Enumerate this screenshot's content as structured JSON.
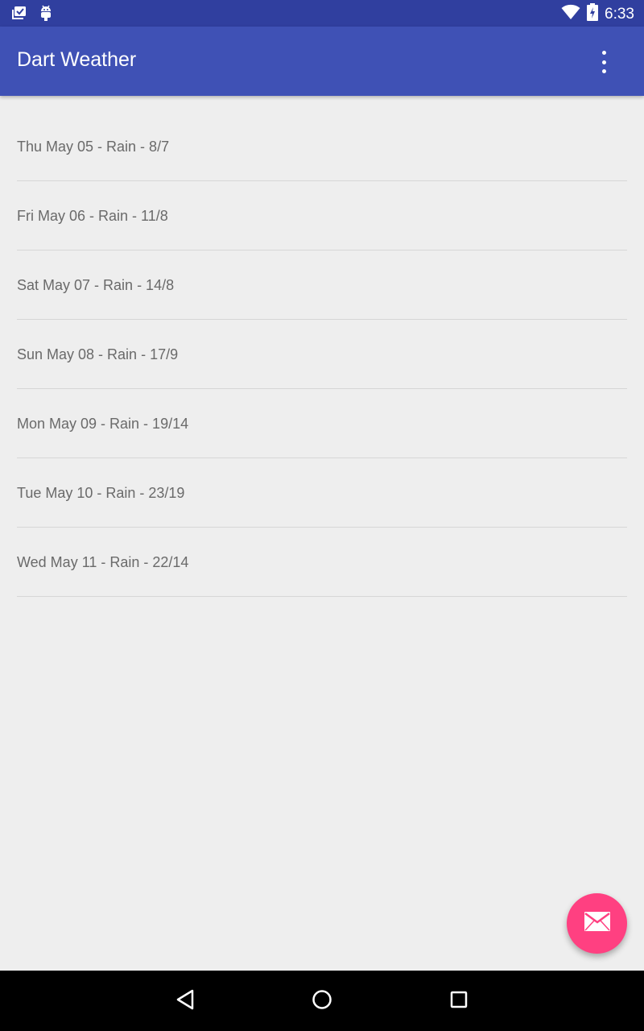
{
  "status_bar": {
    "time": "6:33",
    "icons": [
      "notification-stack-icon",
      "android-icon",
      "wifi-icon",
      "battery-charging-icon"
    ]
  },
  "app_bar": {
    "title": "Dart Weather",
    "overflow_icon": "more-vert-icon"
  },
  "forecast": {
    "items": [
      {
        "label": "Thu May 05 - Rain - 8/7"
      },
      {
        "label": "Fri May 06 - Rain - 11/8"
      },
      {
        "label": "Sat May 07 - Rain - 14/8"
      },
      {
        "label": "Sun May 08 - Rain - 17/9"
      },
      {
        "label": "Mon May 09 - Rain - 19/14"
      },
      {
        "label": "Tue May 10 - Rain - 23/19"
      },
      {
        "label": "Wed May 11 - Rain - 22/14"
      }
    ]
  },
  "fab": {
    "icon": "email-icon"
  },
  "nav_bar": {
    "icons": [
      "back-icon",
      "home-icon",
      "recents-icon"
    ]
  },
  "colors": {
    "status_bar": "#303f9f",
    "app_bar": "#3f51b5",
    "accent": "#ff4081",
    "background": "#eeeeee",
    "text": "#6a6a6a"
  }
}
